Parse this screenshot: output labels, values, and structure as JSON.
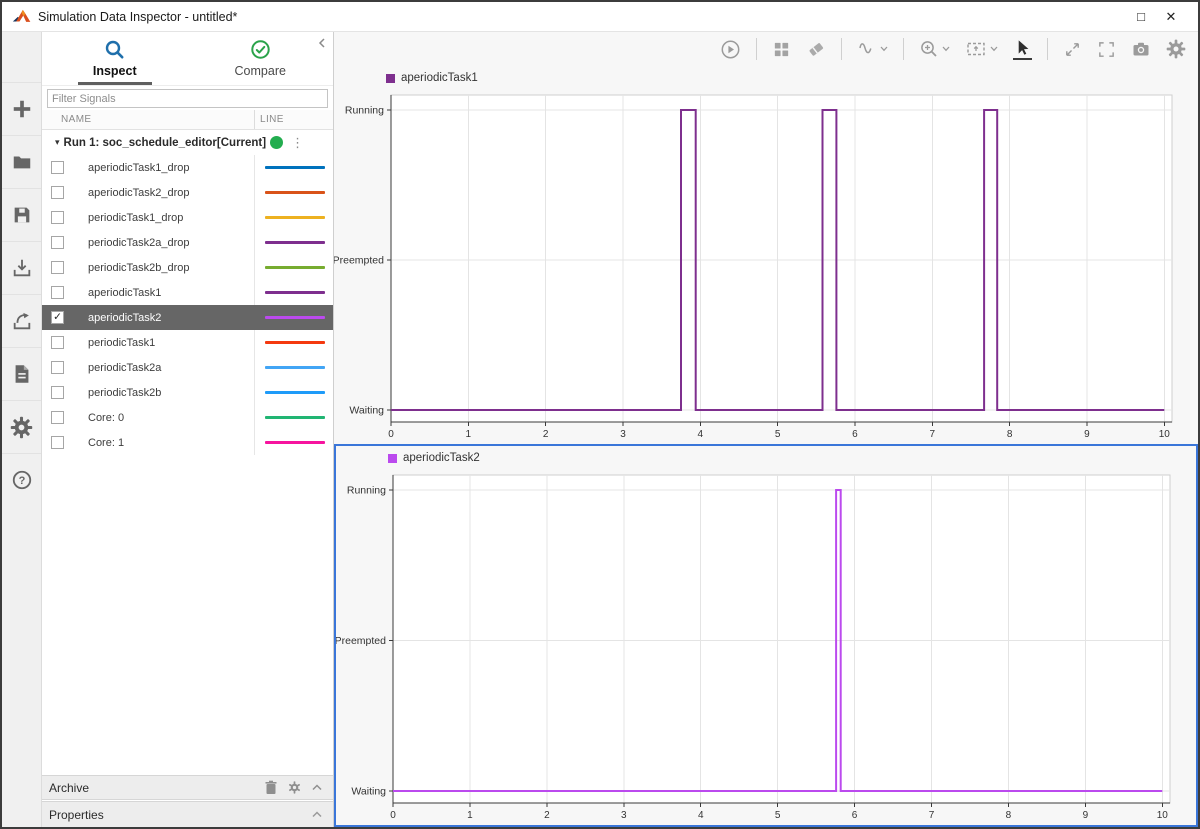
{
  "window": {
    "title": "Simulation Data Inspector - untitled*",
    "controls": {
      "maximize": "□",
      "close": "✕"
    }
  },
  "left_toolbar": {
    "icons": [
      "add-icon",
      "open-folder-icon",
      "save-icon",
      "import-icon",
      "export-icon",
      "create-report-icon",
      "preferences-gear-icon",
      "help-icon"
    ]
  },
  "sidebar": {
    "tabs": [
      {
        "label": "Inspect",
        "icon": "magnifier-icon",
        "active": true
      },
      {
        "label": "Compare",
        "icon": "check-circle-icon",
        "active": false
      }
    ],
    "collapse_icon": "chevron-left-icon",
    "filter": {
      "placeholder": "Filter Signals"
    },
    "table": {
      "columns": {
        "name": "NAME",
        "line": "LINE"
      }
    },
    "run": {
      "caret": "▾",
      "label": "Run 1: soc_schedule_editor[Current]",
      "status_color": "#23ad4f",
      "menu_icon": "kebab-menu-icon",
      "kebab": "⋮"
    },
    "signals": [
      {
        "name": "aperiodicTask1_drop",
        "checked": false,
        "selected": false,
        "color": "#0072BD"
      },
      {
        "name": "aperiodicTask2_drop",
        "checked": false,
        "selected": false,
        "color": "#D95319"
      },
      {
        "name": "periodicTask1_drop",
        "checked": false,
        "selected": false,
        "color": "#EDB120"
      },
      {
        "name": "periodicTask2a_drop",
        "checked": false,
        "selected": false,
        "color": "#7E2F8E"
      },
      {
        "name": "periodicTask2b_drop",
        "checked": false,
        "selected": false,
        "color": "#77AC30"
      },
      {
        "name": "aperiodicTask1",
        "checked": false,
        "selected": false,
        "color": "#7E2F8E"
      },
      {
        "name": "aperiodicTask2",
        "checked": true,
        "selected": true,
        "color": "#BB4AEE"
      },
      {
        "name": "periodicTask1",
        "checked": false,
        "selected": false,
        "color": "#F4390F"
      },
      {
        "name": "periodicTask2a",
        "checked": false,
        "selected": false,
        "color": "#42A5F5"
      },
      {
        "name": "periodicTask2b",
        "checked": false,
        "selected": false,
        "color": "#1E9BF9"
      },
      {
        "name": "Core: 0",
        "checked": false,
        "selected": false,
        "color": "#21B573"
      },
      {
        "name": "Core: 1",
        "checked": false,
        "selected": false,
        "color": "#F6149E"
      }
    ],
    "archive": {
      "label": "Archive",
      "icons": [
        "trash-icon",
        "gear-icon",
        "collapse-chevron-icon"
      ]
    },
    "properties": {
      "label": "Properties",
      "icons": [
        "collapse-chevron-icon"
      ]
    }
  },
  "plot_toolbar": {
    "icons": [
      "replay-icon",
      "layout-grid-icon",
      "eraser-icon",
      "signal-wave-icon",
      "zoom-in-icon",
      "fit-to-view-icon",
      "cursor-arrow-icon",
      "expand-icon",
      "fullscreen-icon",
      "camera-icon",
      "settings-gear-icon"
    ],
    "selected_tool": "cursor-arrow-icon"
  },
  "chart_data": [
    {
      "type": "line",
      "legend": "aperiodicTask1",
      "color": "#7E2F8E",
      "x_ticks": [
        0,
        1,
        2,
        3,
        4,
        5,
        6,
        7,
        8,
        9,
        10
      ],
      "xlim": [
        0,
        10.1
      ],
      "ylim": [
        -0.08,
        2.1
      ],
      "y_ticks": [
        {
          "value": 0,
          "label": "Waiting"
        },
        {
          "value": 1,
          "label": "Preempted"
        },
        {
          "value": 2,
          "label": "Running"
        }
      ],
      "grid": true,
      "legend_position": "top-left",
      "series": [
        {
          "name": "aperiodicTask1",
          "points": [
            [
              0,
              0
            ],
            [
              3.75,
              0
            ],
            [
              3.75,
              2
            ],
            [
              3.94,
              2
            ],
            [
              3.94,
              0
            ],
            [
              5.58,
              0
            ],
            [
              5.58,
              2
            ],
            [
              5.76,
              2
            ],
            [
              5.76,
              0
            ],
            [
              7.67,
              0
            ],
            [
              7.67,
              2
            ],
            [
              7.84,
              2
            ],
            [
              7.84,
              0
            ],
            [
              10,
              0
            ]
          ]
        }
      ],
      "selected": false
    },
    {
      "type": "line",
      "legend": "aperiodicTask2",
      "color": "#BB4AEE",
      "x_ticks": [
        0,
        1,
        2,
        3,
        4,
        5,
        6,
        7,
        8,
        9,
        10
      ],
      "xlim": [
        0,
        10.1
      ],
      "ylim": [
        -0.08,
        2.1
      ],
      "y_ticks": [
        {
          "value": 0,
          "label": "Waiting"
        },
        {
          "value": 1,
          "label": "Preempted"
        },
        {
          "value": 2,
          "label": "Running"
        }
      ],
      "grid": true,
      "legend_position": "top-left",
      "series": [
        {
          "name": "aperiodicTask2",
          "points": [
            [
              0,
              0
            ],
            [
              5.76,
              0
            ],
            [
              5.76,
              2
            ],
            [
              5.82,
              2
            ],
            [
              5.82,
              0
            ],
            [
              10,
              0
            ]
          ]
        }
      ],
      "selected": true
    }
  ]
}
